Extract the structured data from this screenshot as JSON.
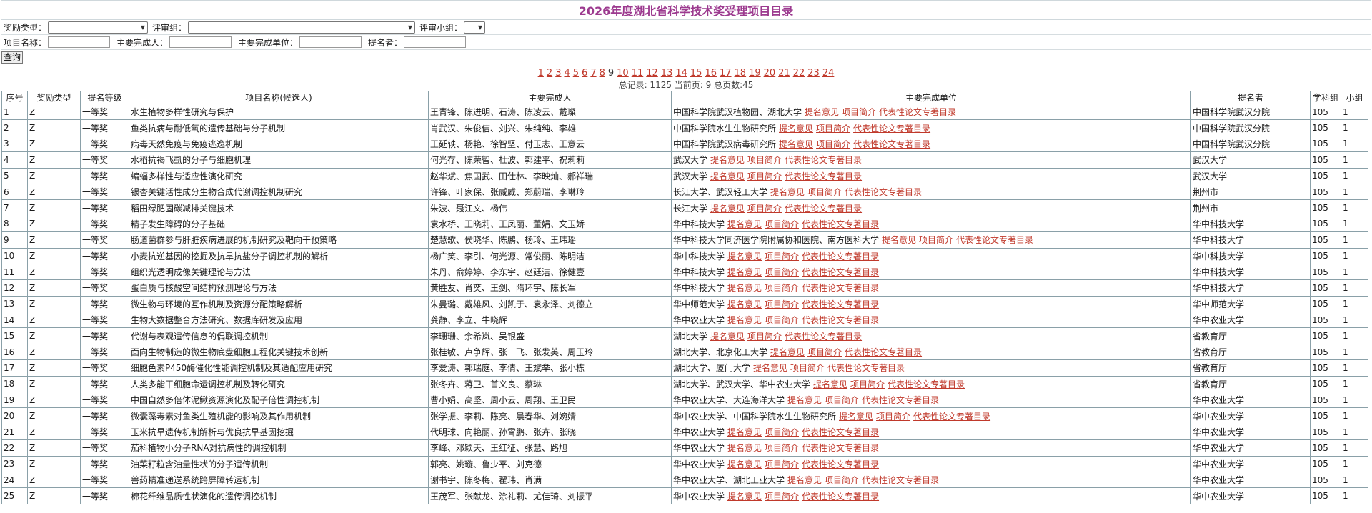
{
  "title": "2026年度湖北省科学技术奖受理项目目录",
  "filters": {
    "award_type_label": "奖励类型：",
    "review_group_label": "评审组：",
    "review_subgroup_label": "评审小组：",
    "project_name_label": "项目名称：",
    "main_person_label": "主要完成人：",
    "main_unit_label": "主要完成单位：",
    "nominator_label": "提名者：",
    "query_button": "查询"
  },
  "pager": {
    "pages": [
      "1",
      "2",
      "3",
      "4",
      "5",
      "6",
      "7",
      "8",
      "9",
      "10",
      "11",
      "12",
      "13",
      "14",
      "15",
      "16",
      "17",
      "18",
      "19",
      "20",
      "21",
      "22",
      "23",
      "24"
    ],
    "current": "9",
    "summary": "总记录: 1125  当前页: 9 总页数:45"
  },
  "table": {
    "headers": [
      "序号",
      "奖励类型",
      "提名等级",
      "项目名称(候选人)",
      "主要完成人",
      "主要完成单位",
      "提名者",
      "学科组",
      "小组"
    ],
    "link_labels": [
      "提名意见",
      "项目简介",
      "代表性论文专著目录"
    ],
    "rows": [
      {
        "no": "1",
        "type": "Z",
        "level": "一等奖",
        "name": "水生植物多样性研究与保护",
        "persons": "王青锋、陈进明、石涛、陈凌云、戴璨",
        "unit": "中国科学院武汉植物园、湖北大学",
        "nominator": "中国科学院武汉分院",
        "group": "105",
        "sub": "1"
      },
      {
        "no": "2",
        "type": "Z",
        "level": "一等奖",
        "name": "鱼类抗病与耐低氧的遗传基础与分子机制",
        "persons": "肖武汉、朱俊佶、刘兴、朱纯纯、李雄",
        "unit": "中国科学院水生生物研究所",
        "nominator": "中国科学院武汉分院",
        "group": "105",
        "sub": "1"
      },
      {
        "no": "3",
        "type": "Z",
        "level": "一等奖",
        "name": "病毒天然免疫与免疫逃逸机制",
        "persons": "王延轶、杨艳、徐智坚、付玉志、王意云",
        "unit": "中国科学院武汉病毒研究所",
        "nominator": "中国科学院武汉分院",
        "group": "105",
        "sub": "1"
      },
      {
        "no": "4",
        "type": "Z",
        "level": "一等奖",
        "name": "水稻抗褐飞虱的分子与细胞机理",
        "persons": "何光存、陈荣智、杜波、郭建平、祝莉莉",
        "unit": "武汉大学",
        "nominator": "武汉大学",
        "group": "105",
        "sub": "1"
      },
      {
        "no": "5",
        "type": "Z",
        "level": "一等奖",
        "name": "蝙蝠多样性与适应性演化研究",
        "persons": "赵华斌、焦国武、田仕林、李映灿、郝祥瑞",
        "unit": "武汉大学",
        "nominator": "武汉大学",
        "group": "105",
        "sub": "1"
      },
      {
        "no": "6",
        "type": "Z",
        "level": "一等奖",
        "name": "银杏关键活性成分生物合成代谢调控机制研究",
        "persons": "许锋、叶家保、张威威、郑蔚瑞、李琳玲",
        "unit": "长江大学、武汉轻工大学",
        "nominator": "荆州市",
        "group": "105",
        "sub": "1"
      },
      {
        "no": "7",
        "type": "Z",
        "level": "一等奖",
        "name": "稻田绿肥固碳减排关键技术",
        "persons": "朱波、聂江文、杨伟",
        "unit": "长江大学",
        "nominator": "荆州市",
        "group": "105",
        "sub": "1"
      },
      {
        "no": "8",
        "type": "Z",
        "level": "一等奖",
        "name": "精子发生障碍的分子基础",
        "persons": "袁水桥、王晓莉、王凤丽、董娟、文玉娇",
        "unit": "华中科技大学",
        "nominator": "华中科技大学",
        "group": "105",
        "sub": "1"
      },
      {
        "no": "9",
        "type": "Z",
        "level": "一等奖",
        "name": "肠道菌群参与肝脏疾病进展的机制研究及靶向干预策略",
        "persons": "楚慧歌、侯晓华、陈鹏、杨玲、王玮瑶",
        "unit": "华中科技大学同济医学院附属协和医院、南方医科大学",
        "nominator": "华中科技大学",
        "group": "105",
        "sub": "1"
      },
      {
        "no": "10",
        "type": "Z",
        "level": "一等奖",
        "name": "小麦抗逆基因的挖掘及抗旱抗盐分子调控机制的解析",
        "persons": "杨广笑、李引、何光源、常俊丽、陈明洁",
        "unit": "华中科技大学",
        "nominator": "华中科技大学",
        "group": "105",
        "sub": "1"
      },
      {
        "no": "11",
        "type": "Z",
        "level": "一等奖",
        "name": "组织光透明成像关键理论与方法",
        "persons": "朱丹、俞婷婷、李东宇、赵廷洁、徐健壹",
        "unit": "华中科技大学",
        "nominator": "华中科技大学",
        "group": "105",
        "sub": "1"
      },
      {
        "no": "12",
        "type": "Z",
        "level": "一等奖",
        "name": "蛋白质与核酸空间结构预测理论与方法",
        "persons": "黄胜友、肖奕、王剑、隋环宇、陈长军",
        "unit": "华中科技大学",
        "nominator": "华中科技大学",
        "group": "105",
        "sub": "1"
      },
      {
        "no": "13",
        "type": "Z",
        "level": "一等奖",
        "name": "微生物与环境的互作机制及资源分配策略解析",
        "persons": "朱曼璐、戴雄风、刘凯于、袁永泽、刘德立",
        "unit": "华中师范大学",
        "nominator": "华中师范大学",
        "group": "105",
        "sub": "1"
      },
      {
        "no": "14",
        "type": "Z",
        "level": "一等奖",
        "name": "生物大数据整合方法研究、数据库研发及应用",
        "persons": "龚静、李立、牛晓辉",
        "unit": "华中农业大学",
        "nominator": "华中农业大学",
        "group": "105",
        "sub": "1"
      },
      {
        "no": "15",
        "type": "Z",
        "level": "一等奖",
        "name": "代谢与表观遗传信息的偶联调控机制",
        "persons": "李珊珊、余希岚、吴银盛",
        "unit": "湖北大学",
        "nominator": "省教育厅",
        "group": "105",
        "sub": "1"
      },
      {
        "no": "16",
        "type": "Z",
        "level": "一等奖",
        "name": "面向生物制造的微生物底盘细胞工程化关键技术创新",
        "persons": "张桂敏、卢争辉、张一飞、张发英、周玉玲",
        "unit": "湖北大学、北京化工大学",
        "nominator": "省教育厅",
        "group": "105",
        "sub": "1"
      },
      {
        "no": "17",
        "type": "Z",
        "level": "一等奖",
        "name": "细胞色素P450酶催化性能调控机制及其适配应用研究",
        "persons": "李爱涛、郭瑞庭、李倩、王斌举、张小栋",
        "unit": "湖北大学、厦门大学",
        "nominator": "省教育厅",
        "group": "105",
        "sub": "1"
      },
      {
        "no": "18",
        "type": "Z",
        "level": "一等奖",
        "name": "人类多能干细胞命运调控机制及转化研究",
        "persons": "张冬卉、蒋卫、首义良、蔡琳",
        "unit": "湖北大学、武汉大学、华中农业大学",
        "nominator": "省教育厅",
        "group": "105",
        "sub": "1"
      },
      {
        "no": "19",
        "type": "Z",
        "level": "一等奖",
        "name": "中国自然多倍体泥鳅资源演化及配子倍性调控机制",
        "persons": "曹小娟、高坚、周小云、周翔、王卫民",
        "unit": "华中农业大学、大连海洋大学",
        "nominator": "华中农业大学",
        "group": "105",
        "sub": "1"
      },
      {
        "no": "20",
        "type": "Z",
        "level": "一等奖",
        "name": "微囊藻毒素对鱼类生殖机能的影响及其作用机制",
        "persons": "张学振、李莉、陈亮、晨春华、刘婉婧",
        "unit": "华中农业大学、中国科学院水生生物研究所",
        "nominator": "华中农业大学",
        "group": "105",
        "sub": "1"
      },
      {
        "no": "21",
        "type": "Z",
        "level": "一等奖",
        "name": "玉米抗旱遗传机制解析与优良抗旱基因挖掘",
        "persons": "代明球、向艳丽、孙霄鹏、张卉、张晓",
        "unit": "华中农业大学",
        "nominator": "华中农业大学",
        "group": "105",
        "sub": "1"
      },
      {
        "no": "22",
        "type": "Z",
        "level": "一等奖",
        "name": "茄科植物小分子RNA对抗病性的调控机制",
        "persons": "李峰、邓颖天、王红征、张慧、路旭",
        "unit": "华中农业大学",
        "nominator": "华中农业大学",
        "group": "105",
        "sub": "1"
      },
      {
        "no": "23",
        "type": "Z",
        "level": "一等奖",
        "name": "油菜籽粒含油量性状的分子遗传机制",
        "persons": "郭亮、姚璇、鲁少平、刘克德",
        "unit": "华中农业大学",
        "nominator": "华中农业大学",
        "group": "105",
        "sub": "1"
      },
      {
        "no": "24",
        "type": "Z",
        "level": "一等奖",
        "name": "兽药精准递送系统跨屏障转运机制",
        "persons": "谢书宇、陈冬梅、翟玮、肖满",
        "unit": "华中农业大学、湖北工业大学",
        "nominator": "华中农业大学",
        "group": "105",
        "sub": "1"
      },
      {
        "no": "25",
        "type": "Z",
        "level": "一等奖",
        "name": "棉花纤维品质性状演化的遗传调控机制",
        "persons": "王茂军、张献龙、涂礼莉、尤佳琦、刘振平",
        "unit": "华中农业大学",
        "nominator": "华中农业大学",
        "group": "105",
        "sub": "1"
      }
    ]
  }
}
